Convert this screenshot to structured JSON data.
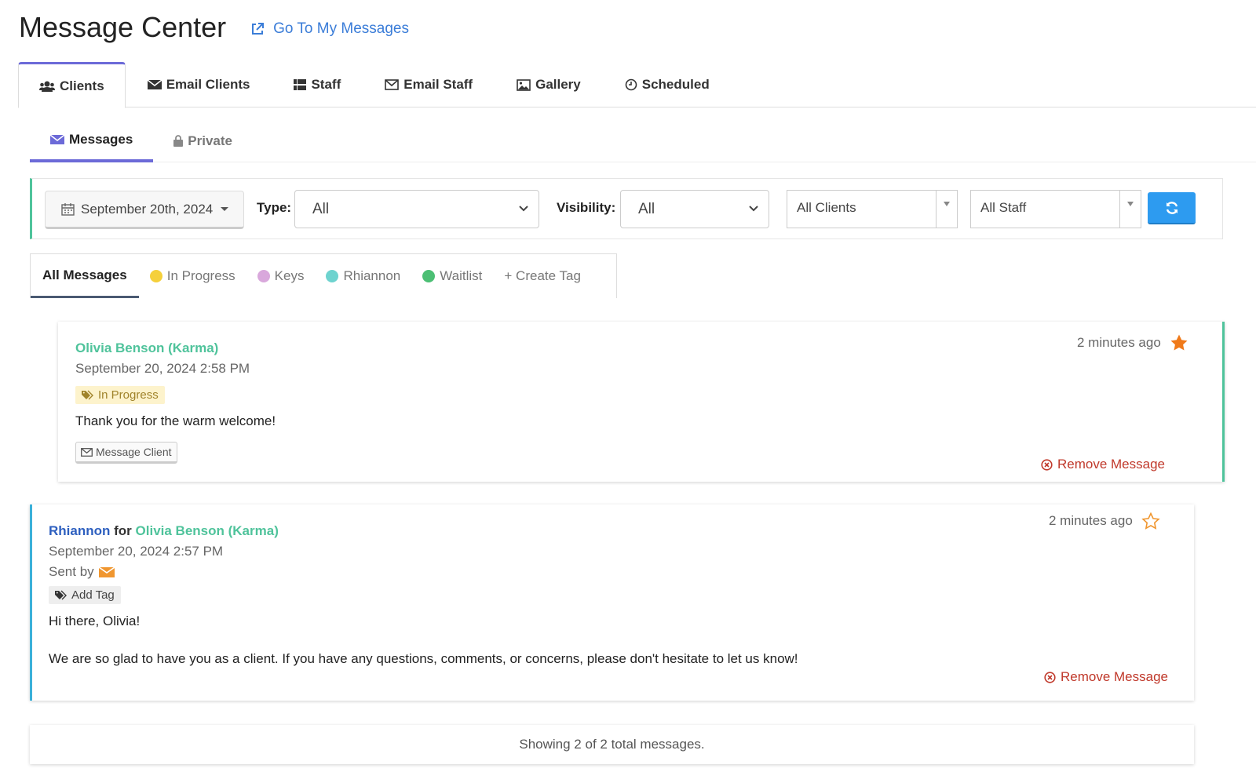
{
  "header": {
    "title": "Message Center",
    "goto_link": "Go To My Messages"
  },
  "main_tabs": [
    {
      "label": "Clients",
      "icon": "users-icon",
      "active": true
    },
    {
      "label": "Email Clients",
      "icon": "envelope-icon",
      "active": false
    },
    {
      "label": "Staff",
      "icon": "grid-icon",
      "active": false
    },
    {
      "label": "Email Staff",
      "icon": "envelope-outline-icon",
      "active": false
    },
    {
      "label": "Gallery",
      "icon": "image-icon",
      "active": false
    },
    {
      "label": "Scheduled",
      "icon": "clock-icon",
      "active": false
    }
  ],
  "sub_tabs": [
    {
      "label": "Messages",
      "icon": "envelope-icon",
      "active": true
    },
    {
      "label": "Private",
      "icon": "lock-icon",
      "active": false
    }
  ],
  "filters": {
    "date": "September 20th, 2024",
    "type_label": "Type:",
    "type_value": "All",
    "visibility_label": "Visibility:",
    "visibility_value": "All",
    "clients_value": "All Clients",
    "staff_value": "All Staff"
  },
  "tag_tabs": {
    "all": "All Messages",
    "tags": [
      {
        "label": "In Progress",
        "color": "#f5d03b"
      },
      {
        "label": "Keys",
        "color": "#d9a8dc"
      },
      {
        "label": "Rhiannon",
        "color": "#6ed3cf"
      },
      {
        "label": "Waitlist",
        "color": "#4cbf74"
      }
    ],
    "create": "+ Create Tag"
  },
  "messages": [
    {
      "sender": "Olivia Benson (Karma)",
      "date": "September 20, 2024 2:58 PM",
      "tag": "In Progress",
      "body": "Thank you for the warm welcome!",
      "time_ago": "2 minutes ago",
      "starred": true,
      "action": "Message Client",
      "remove": "Remove Message"
    },
    {
      "staff": "Rhiannon",
      "for_word": "for",
      "recipient": "Olivia Benson (Karma)",
      "date": "September 20, 2024 2:57 PM",
      "sent_by": "Sent by",
      "tag": "Add Tag",
      "greeting": "Hi there, Olivia!",
      "body": "We are so glad to have you as a client. If you have any questions, comments, or concerns, please don't hesitate to let us know!",
      "time_ago": "2 minutes ago",
      "starred": false,
      "remove": "Remove Message"
    }
  ],
  "footer": "Showing 2 of 2 total messages.",
  "colors": {
    "accent": "#6c6ad8",
    "green": "#4fc39b",
    "blue_button": "#2d9bf0",
    "danger": "#c0392b",
    "star": "#f07a1a"
  }
}
